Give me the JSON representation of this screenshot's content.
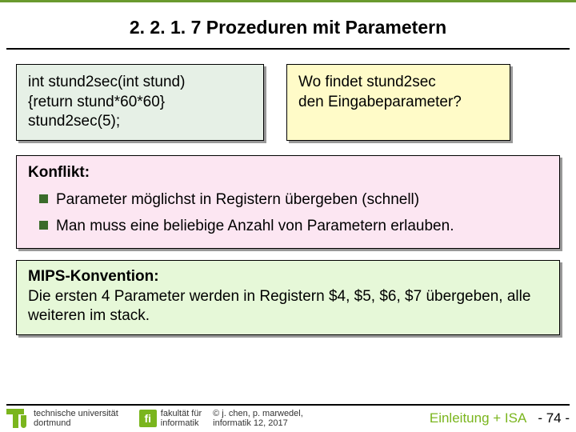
{
  "title": "2. 2. 1. 7 Prozeduren mit Parametern",
  "code": {
    "line1": "int stund2sec(int stund)",
    "line2": "{return stund*60*60}",
    "line3": "stund2sec(5);"
  },
  "question": {
    "line1": "Wo findet stund2sec",
    "line2": "den Eingabeparameter?"
  },
  "konflikt": {
    "label": "Konflikt:",
    "bullet1": "Parameter möglichst in Registern übergeben (schnell)",
    "bullet2": "Man muss eine beliebige Anzahl von Parametern erlauben."
  },
  "mips": {
    "label": "MIPS-Konvention:",
    "body": "Die ersten 4 Parameter werden in Registern $4, $5, $6, $7 übergeben, alle weiteren im stack."
  },
  "footer": {
    "uni1": "technische universität",
    "uni2": "dortmund",
    "fi": "fi",
    "fak1": "fakultät für",
    "fak2": "informatik",
    "copy1": "© j. chen, p. marwedel,",
    "copy2": "informatik 12,  2017",
    "chapter": "Einleitung + ISA",
    "page": "-  74 -"
  }
}
